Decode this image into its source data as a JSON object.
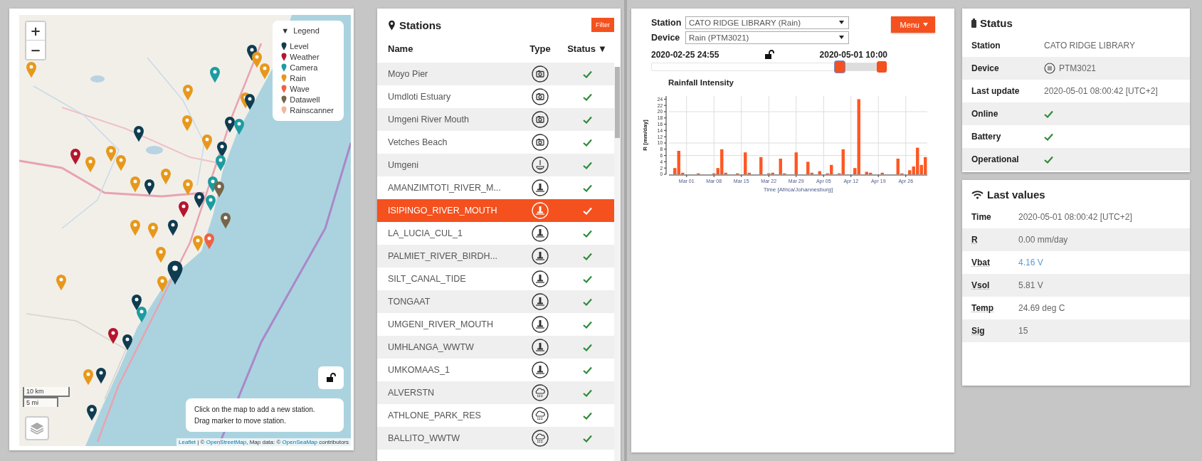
{
  "map": {
    "zoom_in": "+",
    "zoom_out": "−",
    "legend": {
      "toggle": "▼",
      "title": "Legend",
      "items": [
        {
          "label": "Level",
          "color": "#0f3c50"
        },
        {
          "label": "Weather",
          "color": "#b5152d"
        },
        {
          "label": "Camera",
          "color": "#1c9ca0"
        },
        {
          "label": "Rain",
          "color": "#e7981b"
        },
        {
          "label": "Wave",
          "color": "#ee6244"
        },
        {
          "label": "Datawell",
          "color": "#76654a"
        },
        {
          "label": "Rainscanner",
          "color": "#f6b59b"
        }
      ]
    },
    "scale": [
      "10 km",
      "5 mi"
    ],
    "info": [
      "Click on the map to add a new station.",
      "Drag marker to move station."
    ],
    "attribution": [
      {
        "text": "Leaflet",
        "link": true
      },
      {
        "text": " | © ",
        "link": false
      },
      {
        "text": "OpenStreetMap",
        "link": true
      },
      {
        "text": ", Map data: © ",
        "link": false
      },
      {
        "text": "OpenSeaMap",
        "link": true
      },
      {
        "text": " contributors",
        "link": false
      }
    ]
  },
  "stations": {
    "title": "Stations",
    "filter": "Filter",
    "columns": [
      "Name",
      "Type",
      "Status"
    ],
    "sort_mark": "▼",
    "rows": [
      {
        "name": "Moyo Pier",
        "kind": "camera",
        "ok": true,
        "selected": false
      },
      {
        "name": "Umdloti Estuary",
        "kind": "camera",
        "ok": true,
        "selected": false
      },
      {
        "name": "Umgeni River Mouth",
        "kind": "camera",
        "ok": true,
        "selected": false
      },
      {
        "name": "Vetches Beach",
        "kind": "camera",
        "ok": true,
        "selected": false
      },
      {
        "name": "Umgeni",
        "kind": "gauge",
        "ok": true,
        "selected": false
      },
      {
        "name": "AMANZIMTOTI_RIVER_M...",
        "kind": "level",
        "ok": true,
        "selected": false
      },
      {
        "name": "ISIPINGO_RIVER_MOUTH",
        "kind": "level",
        "ok": true,
        "selected": true
      },
      {
        "name": "LA_LUCIA_CUL_1",
        "kind": "level",
        "ok": true,
        "selected": false
      },
      {
        "name": "PALMIET_RIVER_BIRDH...",
        "kind": "level",
        "ok": true,
        "selected": false
      },
      {
        "name": "SILT_CANAL_TIDE",
        "kind": "level",
        "ok": true,
        "selected": false
      },
      {
        "name": "TONGAAT",
        "kind": "level",
        "ok": true,
        "selected": false
      },
      {
        "name": "UMGENI_RIVER_MOUTH",
        "kind": "level",
        "ok": true,
        "selected": false
      },
      {
        "name": "UMHLANGA_WWTW",
        "kind": "level",
        "ok": true,
        "selected": false
      },
      {
        "name": "UMKOMAAS_1",
        "kind": "level",
        "ok": true,
        "selected": false
      },
      {
        "name": "ALVERSTN",
        "kind": "rain",
        "ok": true,
        "selected": false
      },
      {
        "name": "ATHLONE_PARK_RES",
        "kind": "rain",
        "ok": true,
        "selected": false
      },
      {
        "name": "BALLITO_WWTW",
        "kind": "rain",
        "ok": true,
        "selected": false
      }
    ]
  },
  "viewer": {
    "station": {
      "label": "Station",
      "value": "CATO RIDGE LIBRARY (Rain)"
    },
    "device": {
      "label": "Device",
      "value": "Rain (PTM3021)"
    },
    "menu": "Menu",
    "range": {
      "start": "2020-02-25 24:55",
      "end": "2020-05-01 10:00",
      "thumbs": [
        {
          "level": 0.8
        },
        {
          "level": 0.98
        }
      ]
    },
    "chart_data": {
      "type": "bar",
      "title": "Rainfall Intensity",
      "xlabel": "Time [Africa/Johannesburg]",
      "ylabel": "R [mm/day]",
      "categories": [
        null,
        null,
        null,
        null,
        "Mar 01",
        null,
        null,
        null,
        null,
        null,
        null,
        "Mar 08",
        null,
        null,
        null,
        null,
        null,
        null,
        "Mar 15",
        null,
        null,
        null,
        null,
        null,
        null,
        "Mar 22",
        null,
        null,
        null,
        null,
        null,
        null,
        "Mar 29",
        null,
        null,
        null,
        null,
        null,
        null,
        "Apr 05",
        null,
        null,
        null,
        null,
        null,
        null,
        "Apr 12",
        null,
        null,
        null,
        null,
        null,
        null,
        "Apr 19",
        null,
        null,
        null,
        null,
        null,
        null,
        "Apr 26",
        null,
        null,
        null,
        null,
        null
      ],
      "series": [
        {
          "color": "#ff5722",
          "values": [
            null,
            2,
            7.5,
            0.5,
            null,
            null,
            null,
            0.3,
            null,
            null,
            null,
            0.3,
            2,
            8,
            0.5,
            null,
            null,
            0.3,
            null,
            7,
            0.5,
            null,
            null,
            5.5,
            null,
            0.3,
            0.5,
            null,
            5,
            0.3,
            null,
            null,
            7,
            null,
            null,
            4,
            0.5,
            null,
            1,
            null,
            0.3,
            3,
            null,
            0.3,
            8,
            null,
            null,
            2,
            24,
            null,
            0.8,
            0.5,
            null,
            null,
            0.5,
            null,
            null,
            null,
            5,
            0.3,
            null,
            1.3,
            2.5,
            8.5,
            3,
            5.5
          ]
        }
      ],
      "ylim": [
        0,
        25
      ],
      "grid": true,
      "yticks": [
        0,
        2,
        4,
        6,
        8,
        10,
        12,
        14,
        16,
        18,
        20,
        22,
        24
      ]
    }
  },
  "status": {
    "title": "Status",
    "rows": [
      {
        "label": "Station",
        "kind": "text",
        "value": "CATO RIDGE LIBRARY"
      },
      {
        "label": "Device",
        "kind": "device",
        "value": "PTM3021"
      },
      {
        "label": "Last update",
        "kind": "text",
        "value": "2020-05-01 08:00:42 [UTC+2]"
      },
      {
        "label": "Online",
        "kind": "check",
        "ok": true
      },
      {
        "label": "Battery",
        "kind": "check",
        "ok": true
      },
      {
        "label": "Operational",
        "kind": "check",
        "ok": true
      }
    ]
  },
  "last_values": {
    "title": "Last values",
    "rows": [
      {
        "label": "Time",
        "value": "2020-05-01 08:00:42 [UTC+2]",
        "abbr": false,
        "highlight": false
      },
      {
        "label": "R",
        "value": "0.00 mm/day",
        "abbr": true,
        "highlight": false
      },
      {
        "label": "Vbat",
        "value": "4.16 V",
        "abbr": true,
        "highlight": true
      },
      {
        "label": "Vsol",
        "value": "5.81 V",
        "abbr": true,
        "highlight": false
      },
      {
        "label": "Temp",
        "value": "24.69 deg C",
        "abbr": true,
        "highlight": false
      },
      {
        "label": "Sig",
        "value": "15",
        "abbr": true,
        "highlight": false
      }
    ]
  }
}
